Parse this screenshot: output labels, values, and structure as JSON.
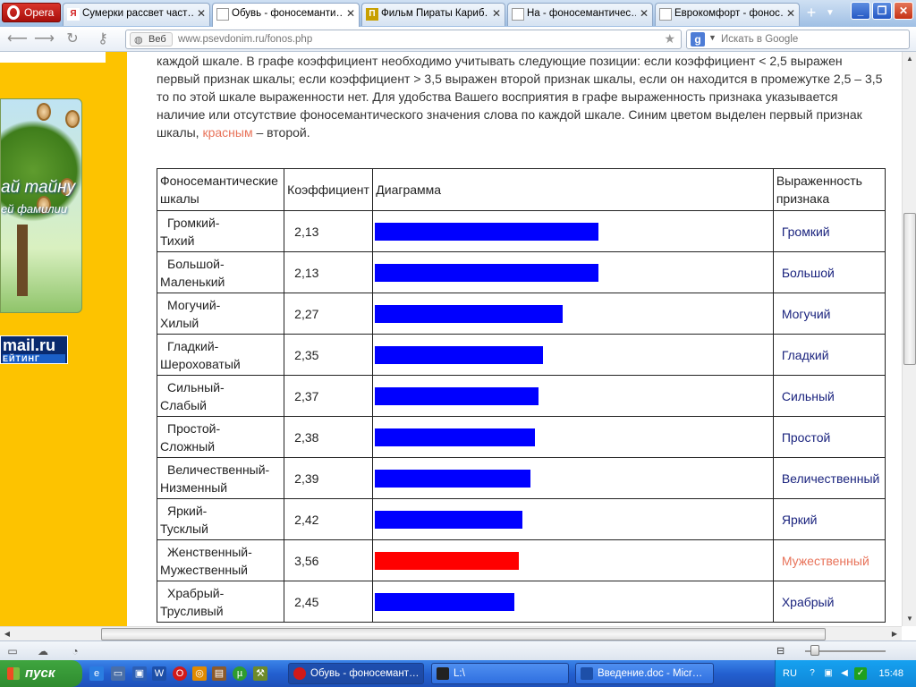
{
  "browser": {
    "menu_label": "Opera",
    "tabs": [
      {
        "title": "Сумерки рассвет част…",
        "icon": "Я",
        "icon_color": "#d11a1a",
        "active": false
      },
      {
        "title": "Обувь - фоносеманти…",
        "icon": "",
        "icon_color": "#ffffff",
        "active": true
      },
      {
        "title": "Фильм Пираты Кариб…",
        "icon": "П",
        "icon_color": "#c8a000",
        "active": false
      },
      {
        "title": "На - фоносемантичес…",
        "icon": "",
        "icon_color": "#ffffff",
        "active": false
      },
      {
        "title": "Еврокомфорт - фонос…",
        "icon": "",
        "icon_color": "#ffffff",
        "active": false
      }
    ],
    "address": {
      "badge": "Веб",
      "url": "www.psevdonim.ru/fonos.php"
    },
    "search": {
      "placeholder": "Искать в Google"
    }
  },
  "sidebar": {
    "banner_line1": "ай тайну",
    "banner_line2": "ей фамилии",
    "rating_main": "mail.ru",
    "rating_sub": "ЕЙТИНГ"
  },
  "page": {
    "paragraph_main": "каждой шкале. В графе коэффициент необходимо учитывать следующие позиции: если коэффициент < 2,5 выражен первый признак шкалы; если коэффициент > 3,5 выражен второй признак шкалы, если он находится в промежутке 2,5 – 3,5 то по этой шкале выраженности нет. Для удобства Вашего восприятия в графе выраженность признака указывается наличие или отсутствие фоносемантического значения слова по каждой шкале. Синим цветом выделен первый признак шкалы, ",
    "paragraph_red": "красным",
    "paragraph_end": " – второй.",
    "table": {
      "headers": {
        "scales": "Фоносемантические шкалы",
        "coefficient": "Коэффициент",
        "diagram": "Диаграмма",
        "expression": "Выраженность признака"
      },
      "rows": [
        {
          "scale1": "Громкий-",
          "scale2": "Тихий",
          "coef": "2,13",
          "expression": "Громкий",
          "bar": 0.56,
          "color": "blue"
        },
        {
          "scale1": "Большой-",
          "scale2": "Маленький",
          "coef": "2,13",
          "expression": "Большой",
          "bar": 0.56,
          "color": "blue"
        },
        {
          "scale1": "Могучий-",
          "scale2": "Хилый",
          "coef": "2,27",
          "expression": "Могучий",
          "bar": 0.47,
          "color": "blue"
        },
        {
          "scale1": "Гладкий-",
          "scale2": "Шероховатый",
          "coef": "2,35",
          "expression": "Гладкий",
          "bar": 0.42,
          "color": "blue"
        },
        {
          "scale1": "Сильный-",
          "scale2": "Слабый",
          "coef": "2,37",
          "expression": "Сильный",
          "bar": 0.41,
          "color": "blue"
        },
        {
          "scale1": "Простой-",
          "scale2": "Сложный",
          "coef": "2,38",
          "expression": "Простой",
          "bar": 0.4,
          "color": "blue"
        },
        {
          "scale1": "Величественный-",
          "scale2": "Низменный",
          "coef": "2,39",
          "expression": "Величественный",
          "bar": 0.39,
          "color": "blue"
        },
        {
          "scale1": "Яркий-",
          "scale2": "Тусклый",
          "coef": "2,42",
          "expression": "Яркий",
          "bar": 0.37,
          "color": "blue"
        },
        {
          "scale1": "Женственный-",
          "scale2": "Мужественный",
          "coef": "3,56",
          "expression": "Мужественный",
          "bar": 0.36,
          "color": "red"
        },
        {
          "scale1": "Храбрый-",
          "scale2": "Трусливый",
          "coef": "2,45",
          "expression": "Храбрый",
          "bar": 0.35,
          "color": "blue"
        }
      ]
    }
  },
  "colors": {
    "blue": "#0000ff",
    "red": "#ff0000",
    "sidebar": "#fdc300",
    "expression_blue": "#1a237e",
    "expression_red": "#e8735a"
  },
  "taskbar": {
    "start_label": "пуск",
    "tasks": [
      {
        "label": "Обувь - фоносемант…",
        "active": true
      },
      {
        "label": "L:\\",
        "active": false
      },
      {
        "label": "Введение.doc - Micr…",
        "active": false
      }
    ],
    "language": "RU",
    "clock": "15:48"
  }
}
